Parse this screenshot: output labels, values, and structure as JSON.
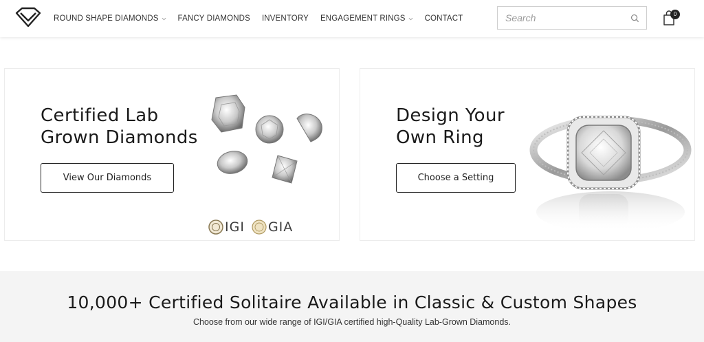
{
  "header": {
    "nav": [
      {
        "label": "ROUND SHAPE DIAMONDS",
        "has_dropdown": true
      },
      {
        "label": "FANCY DIAMONDS",
        "has_dropdown": false
      },
      {
        "label": "INVENTORY",
        "has_dropdown": false
      },
      {
        "label": "ENGAGEMENT RINGS",
        "has_dropdown": true
      },
      {
        "label": "CONTACT",
        "has_dropdown": false
      }
    ],
    "search": {
      "placeholder": "Search",
      "value": ""
    },
    "cart": {
      "count": "0"
    }
  },
  "cards": {
    "left": {
      "title_line1": "Certified Lab",
      "title_line2": "Grown Diamonds",
      "button": "View Our Diamonds",
      "certs": [
        {
          "label": "IGI"
        },
        {
          "label": "GIA"
        }
      ]
    },
    "right": {
      "title_line1": "Design Your",
      "title_line2": "Own Ring",
      "button": "Choose a Setting"
    }
  },
  "band": {
    "title": "10,000+ Certified Solitaire Available in Classic & Custom Shapes",
    "subtitle": "Choose from our wide range of IGI/GIA certified high-Quality Lab-Grown Diamonds."
  },
  "colors": {
    "text": "#1a1a1a",
    "band_bg": "#f4f4f4",
    "badge": "#222222",
    "border": "#cfcfcf"
  }
}
